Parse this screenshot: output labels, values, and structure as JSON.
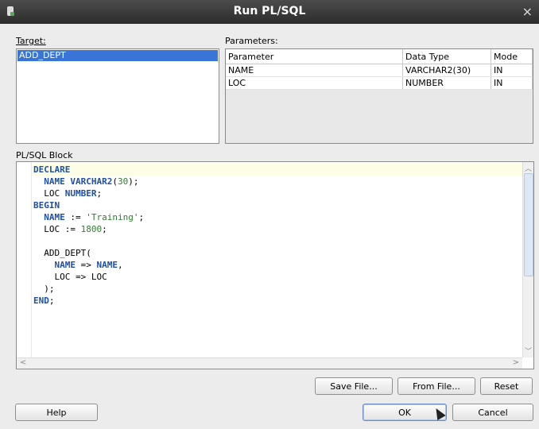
{
  "window": {
    "title": "Run PL/SQL",
    "close_glyph": "×"
  },
  "target": {
    "label": "Target:",
    "items": [
      "ADD_DEPT"
    ]
  },
  "parameters": {
    "label": "Parameters:",
    "columns": [
      "Parameter",
      "Data Type",
      "Mode"
    ],
    "rows": [
      [
        "NAME",
        "VARCHAR2(30)",
        "IN"
      ],
      [
        "LOC",
        "NUMBER",
        "IN"
      ]
    ]
  },
  "plsql_block": {
    "label": "PL/SQL Block",
    "lines": [
      "DECLARE",
      "  NAME VARCHAR2(30);",
      "  LOC NUMBER;",
      "BEGIN",
      "  NAME := 'Training';",
      "  LOC := 1800;",
      "",
      "  ADD_DEPT(",
      "    NAME => NAME,",
      "    LOC => LOC",
      "  );",
      "END;"
    ]
  },
  "buttons": {
    "save_file": "Save File...",
    "from_file": "From File...",
    "reset": "Reset",
    "help": "Help",
    "ok": "OK",
    "cancel": "Cancel"
  },
  "colors": {
    "selection": "#3875d7",
    "keyword": "#1f4fa3",
    "literal": "#2e7d32",
    "current_line": "#fdfde6"
  }
}
